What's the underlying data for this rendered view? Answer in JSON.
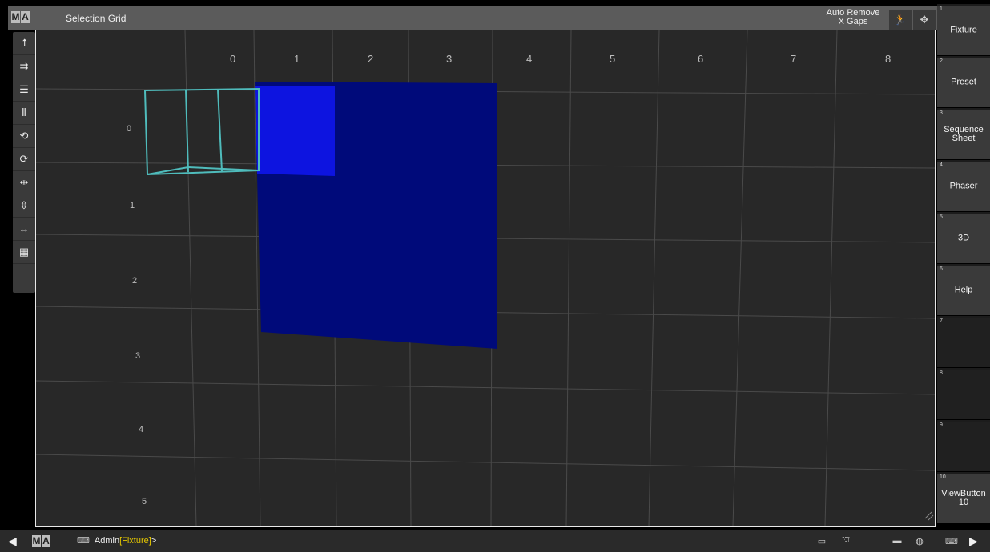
{
  "window": {
    "logo": [
      "M",
      "A"
    ],
    "title": "Selection Grid",
    "auto_remove": {
      "line1": "Auto Remove",
      "line2": "X Gaps"
    }
  },
  "toolbar": {
    "tools": [
      {
        "name": "origin-tool",
        "glyph": "⮥"
      },
      {
        "name": "fid-tool",
        "glyph": "⇉"
      },
      {
        "name": "align-rows-tool",
        "glyph": "☰"
      },
      {
        "name": "align-columns-tool",
        "glyph": "⦀"
      },
      {
        "name": "rotate-left-tool",
        "glyph": "⟲"
      },
      {
        "name": "rotate-right-tool",
        "glyph": "⟳"
      },
      {
        "name": "mirror-horizontal-tool",
        "glyph": "⇹"
      },
      {
        "name": "mirror-vertical-tool",
        "glyph": "⇳"
      },
      {
        "name": "collapse-tool",
        "glyph": "⇔"
      },
      {
        "name": "grid-settings-tool",
        "glyph": "▦"
      }
    ]
  },
  "grid": {
    "column_labels": [
      "0",
      "1",
      "2",
      "3",
      "4",
      "5",
      "6",
      "7",
      "8"
    ],
    "row_labels": [
      "0",
      "1",
      "2",
      "3",
      "4",
      "5"
    ],
    "selection_color": "#000a7a",
    "highlight_color": "#0d14e0",
    "cube_color": "#4fbcbc"
  },
  "view_buttons": [
    {
      "num": "1",
      "label": "Fixture"
    },
    {
      "num": "2",
      "label": "Preset"
    },
    {
      "num": "3",
      "label": "Sequence Sheet"
    },
    {
      "num": "4",
      "label": "Phaser"
    },
    {
      "num": "5",
      "label": "3D"
    },
    {
      "num": "6",
      "label": "Help"
    },
    {
      "num": "7",
      "label": ""
    },
    {
      "num": "8",
      "label": ""
    },
    {
      "num": "9",
      "label": ""
    },
    {
      "num": "10",
      "label": "ViewButton 10"
    }
  ],
  "command_line": {
    "user": "Admin",
    "context": "[Fixture]",
    "prompt": ">"
  }
}
